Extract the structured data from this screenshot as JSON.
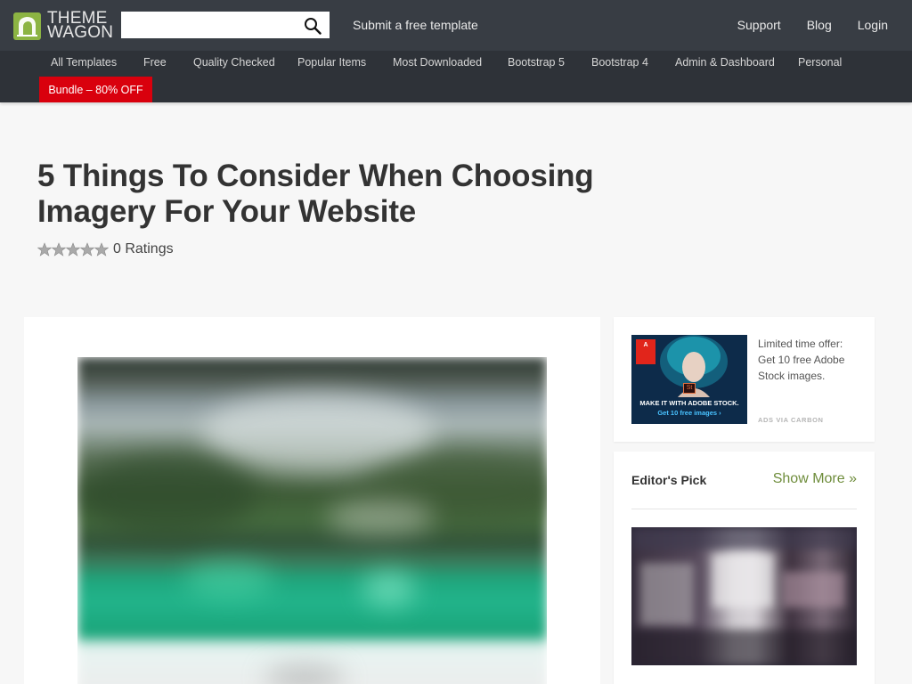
{
  "header": {
    "logo_line1": "THEME",
    "logo_line2": "WAGON",
    "search_placeholder": "",
    "submit_link": "Submit a free template",
    "right_links": [
      "Support",
      "Blog",
      "Login"
    ]
  },
  "category_nav": {
    "items": [
      "All Templates",
      "Free",
      "Quality Checked",
      "Popular Items",
      "Most Downloaded",
      "Bootstrap 5",
      "Bootstrap 4",
      "Admin & Dashboard",
      "Personal"
    ],
    "bundle_label": "Bundle – 80% OFF",
    "bundle_color": "#d9000d"
  },
  "article": {
    "title": "5 Things To Consider When Choosing Imagery For Your Website",
    "rating_value": 0,
    "rating_max": 5,
    "rating_text": "0 Ratings"
  },
  "sidebar": {
    "ad": {
      "image_line1": "MAKE IT WITH ADOBE STOCK.",
      "image_line2": "Get 10 free images ›",
      "text": "Limited time offer: Get 10 free Adobe Stock images.",
      "via": "ADS VIA CARBON"
    },
    "editors_pick": {
      "title": "Editor's Pick",
      "show_more": "Show More »"
    }
  },
  "colors": {
    "topbar": "#383d44",
    "catnav": "#2e3238",
    "accent_green": "#8cb443",
    "link_green": "#6f8d3c"
  }
}
